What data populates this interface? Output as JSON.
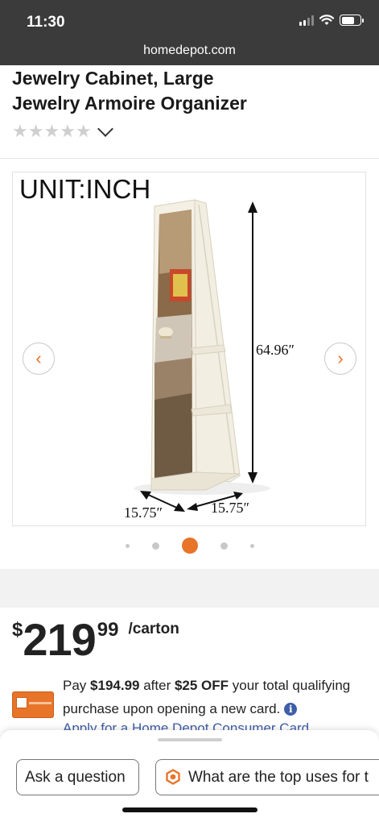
{
  "status_bar": {
    "time": "11:30"
  },
  "browser": {
    "url": "homedepot.com"
  },
  "product": {
    "title_line1": "Jewelry Cabinet, Large",
    "title_line2": "Jewelry Armoire Organizer",
    "rating_stars": "★★★★★"
  },
  "gallery": {
    "unit_label": "UNIT:INCH",
    "height_label": "64.96″",
    "width_label": "15.75″",
    "depth_label": "15.75″",
    "prev_glyph": "‹",
    "next_glyph": "›",
    "active_index": 2,
    "dot_count": 5
  },
  "price": {
    "currency": "$",
    "dollars": "219",
    "cents": "99",
    "unit": "/carton"
  },
  "promo": {
    "pay_prefix": "Pay ",
    "pay_amount": "$194.99",
    "after_text": " after ",
    "discount": "$25 OFF",
    "rest_text": " your total qualifying purchase upon opening a new card.",
    "info_glyph": "i",
    "apply_link": "Apply for a Home Depot Consumer Card"
  },
  "bottom_sheet": {
    "chip_ask": "Ask a question",
    "chip_uses": "What are the top uses for t"
  },
  "colors": {
    "accent": "#e8742a",
    "link": "#3f5ea8",
    "dark_bar": "#3b3b3b"
  },
  "icons": [
    "signal-icon",
    "wifi-icon",
    "battery-icon",
    "chevron-down-icon",
    "chevron-left-icon",
    "chevron-right-icon",
    "info-icon",
    "hexagon-icon"
  ]
}
